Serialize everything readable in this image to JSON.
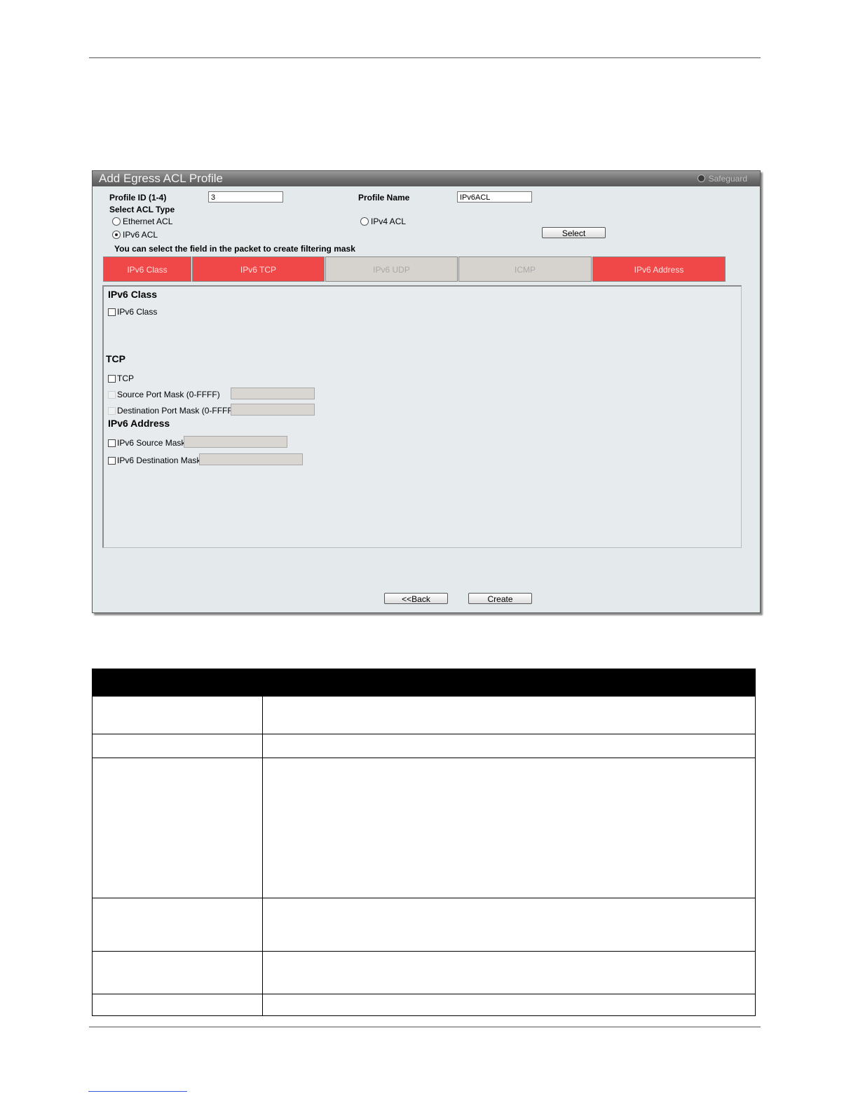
{
  "window": {
    "title": "Add Egress ACL Profile",
    "safeguard": "Safeguard"
  },
  "form": {
    "profile_id_label": "Profile ID (1-4)",
    "profile_id_value": "3",
    "profile_name_label": "Profile Name",
    "profile_name_value": "IPv6ACL",
    "acl_type_label": "Select ACL Type",
    "radio_ethernet": "Ethernet ACL",
    "radio_ipv4": "IPv4 ACL",
    "radio_ipv6": "IPv6 ACL",
    "selected_acl": "IPv6 ACL",
    "select_button": "Select",
    "hint": "You can select the field in the packet to create filtering mask"
  },
  "tabs": [
    {
      "label": "IPv6 Class",
      "active": true
    },
    {
      "label": "IPv6 TCP",
      "active": true
    },
    {
      "label": "IPv6 UDP",
      "active": false
    },
    {
      "label": "ICMP",
      "active": false
    },
    {
      "label": "IPv6 Address",
      "active": true
    }
  ],
  "sections": {
    "class_title": "IPv6 Class",
    "class_check": "IPv6 Class",
    "tcp_title": "TCP",
    "tcp_check": "TCP",
    "src_port_mask": "Source Port Mask (0-FFFF)",
    "dst_port_mask": "Destination Port Mask (0-FFFF)",
    "addr_title": "IPv6 Address",
    "src_mask": "IPv6 Source Mask",
    "dst_mask": "IPv6 Destination Mask"
  },
  "buttons": {
    "back": "<<Back",
    "create": "Create"
  },
  "colors": {
    "tab_active": "#f04848",
    "tab_inactive": "#d6d3cf"
  }
}
